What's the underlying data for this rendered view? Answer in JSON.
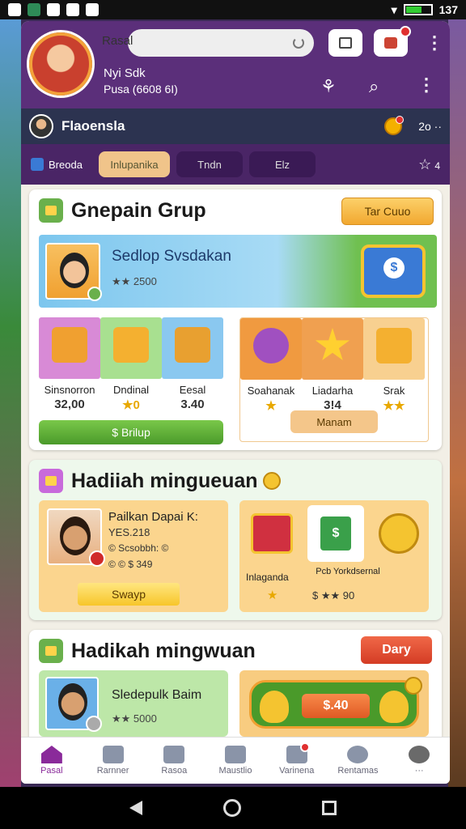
{
  "status_bar": {
    "time": "137"
  },
  "header": {
    "url_label": "Rasal",
    "name_line1": "Nyi Sdk",
    "name_line2": "Pusa (6608 6I)"
  },
  "user_row": {
    "name": "Flaoensla",
    "coins": "2o ··"
  },
  "tabs": [
    {
      "label": "Breoda"
    },
    {
      "label": "Inlupanika"
    },
    {
      "label": "Tndn"
    },
    {
      "label": "Elz"
    }
  ],
  "tab_star_count": "4",
  "card1": {
    "title": "Gnepain Grup",
    "button": "Tar Cuuo",
    "banner_title": "Sedlop Svsdakan",
    "banner_stars": "★★ 2500",
    "items_left": [
      {
        "label": "Sinsnorron",
        "value": "32,00"
      },
      {
        "label": "Dndinal",
        "value": "★0"
      },
      {
        "label": "Eesal",
        "value": "3.40"
      }
    ],
    "items_right": [
      {
        "label": "Soahanak",
        "value": "★"
      },
      {
        "label": "Liadarha",
        "value": "3!4"
      },
      {
        "label": "Srak",
        "value": "★★"
      }
    ],
    "green_button": "$ Brilup",
    "peach_button": "Manam"
  },
  "card2": {
    "title": "Hadiiah mingueuan",
    "reward_title": "Pailkan Dapai K:",
    "reward_line2": "YES.218",
    "reward_line3": "© Scsobbh: ©",
    "reward_line4": "© © $ 349",
    "yellow_button": "Swayp",
    "right_label1": "Inlaganda",
    "right_label2": "Pcb Yorkdsernal",
    "right_value": "$ ★★ 90"
  },
  "card3": {
    "title": "Hadikah mingwuan",
    "button": "Dary",
    "weekly_title": "Sledepulk Baim",
    "weekly_stars": "★★ 5000",
    "value_pill": "$.40"
  },
  "bottom_nav": [
    {
      "label": "Pasal",
      "icon": "home-icon"
    },
    {
      "label": "Rarnner",
      "icon": "rocket-icon"
    },
    {
      "label": "Rasoa",
      "icon": "calendar-icon"
    },
    {
      "label": "Maustlio",
      "icon": "mail-icon"
    },
    {
      "label": "Varinena",
      "icon": "shop-icon"
    },
    {
      "label": "Rentamas",
      "icon": "profile-icon"
    },
    {
      "label": "···",
      "icon": "settings-icon"
    }
  ]
}
